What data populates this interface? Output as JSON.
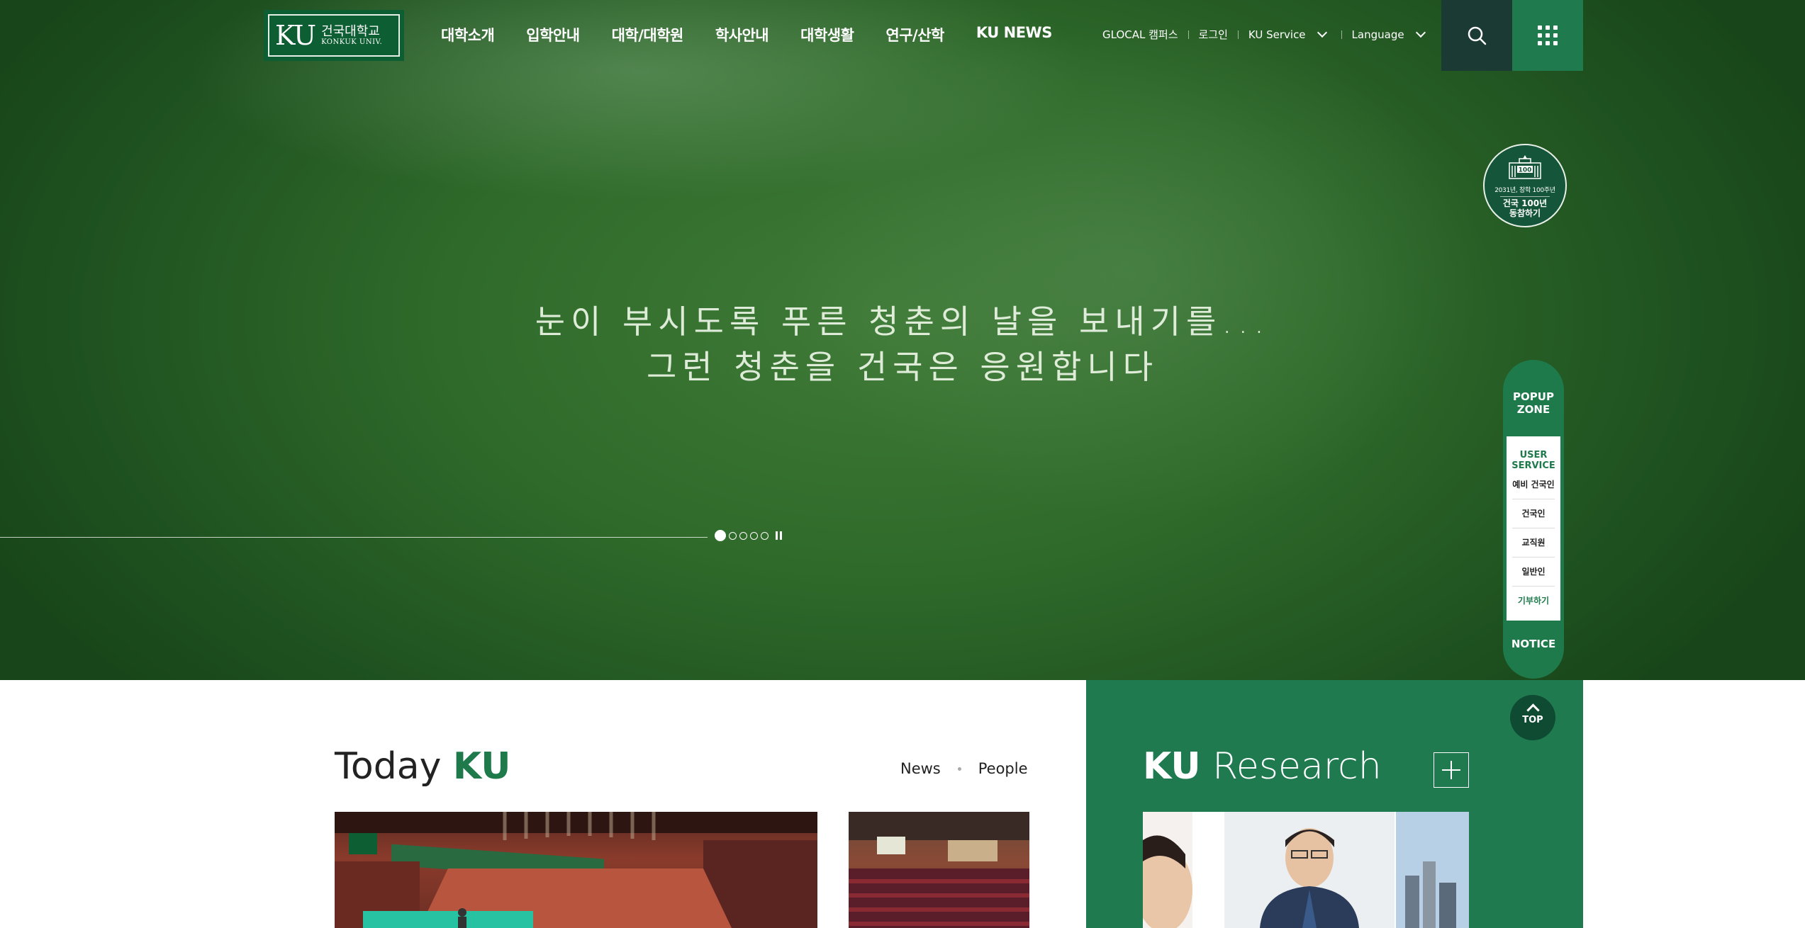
{
  "hero": {
    "headline_line1": "눈이 부시도록 푸른 청춘의 날을 보내기를...",
    "headline_line2": "그런 청춘을 건국은 응원합니다"
  },
  "logo": {
    "mark": "KU",
    "korean": "건국대학교",
    "english": "KONKUK UNIV."
  },
  "nav": {
    "items": [
      "대학소개",
      "입학안내",
      "대학/대학원",
      "학사안내",
      "대학생활",
      "연구/산학",
      "KU NEWS"
    ]
  },
  "utility": {
    "glocal": "GLOCAL 캠퍼스",
    "login": "로그인",
    "ku_service": "KU Service",
    "language": "Language"
  },
  "badge": {
    "sub": "2031년, 창학 100주년",
    "line1": "건국 100년",
    "line2": "동참하기"
  },
  "quick_menu": {
    "popup_line1": "POPUP",
    "popup_line2": "ZONE",
    "user_service_line1": "USER",
    "user_service_line2": "SERVICE",
    "items": [
      "예비 건국인",
      "건국인",
      "교직원",
      "일반인",
      "기부하기"
    ],
    "notice": "NOTICE"
  },
  "slider": {
    "total": 5,
    "active": 1
  },
  "today": {
    "title_prefix": "Today",
    "title_brand": "KU",
    "tabs": [
      "News",
      "People"
    ]
  },
  "research": {
    "title_brand": "KU",
    "title_rest": "Research"
  },
  "top_button": "TOP",
  "icons": [
    "search-icon",
    "grid-menu-icon",
    "chevron-down-icon",
    "plus-icon",
    "arrow-up-icon",
    "pause-icon"
  ],
  "colors": {
    "brand_green": "#1e7a4b",
    "dark_green": "#0e5e33",
    "search_bg": "#1b3a33"
  }
}
